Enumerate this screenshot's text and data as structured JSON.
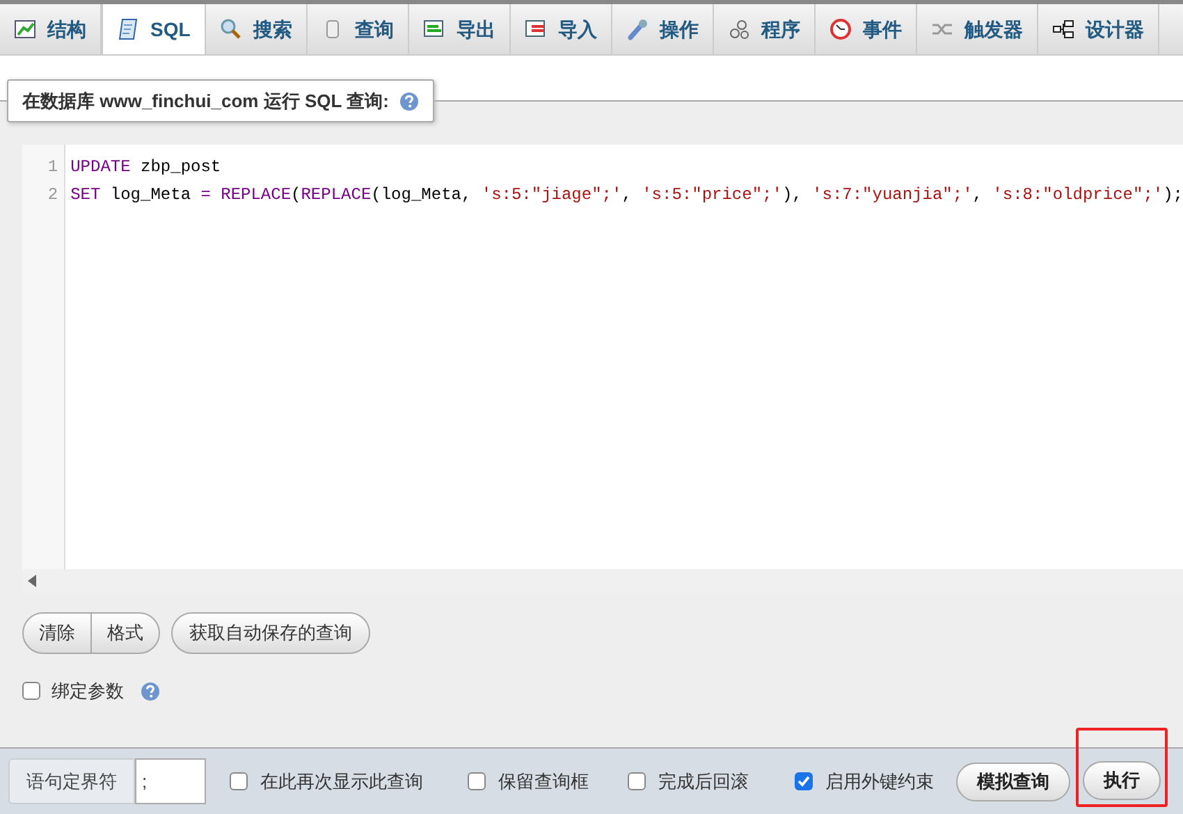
{
  "tabs": [
    {
      "label": "结构",
      "selected": false
    },
    {
      "label": "SQL",
      "selected": true
    },
    {
      "label": "搜索",
      "selected": false
    },
    {
      "label": "查询",
      "selected": false
    },
    {
      "label": "导出",
      "selected": false
    },
    {
      "label": "导入",
      "selected": false
    },
    {
      "label": "操作",
      "selected": false
    },
    {
      "label": "程序",
      "selected": false
    },
    {
      "label": "事件",
      "selected": false
    },
    {
      "label": "触发器",
      "selected": false
    },
    {
      "label": "设计器",
      "selected": false
    }
  ],
  "panel": {
    "title": "在数据库 www_finchui_com 运行 SQL 查询:"
  },
  "editor": {
    "lines": [
      {
        "number": "1",
        "tokens": [
          {
            "kind": "keyword",
            "text": "UPDATE"
          },
          {
            "kind": "plain",
            "text": " zbp_post"
          }
        ]
      },
      {
        "number": "2",
        "tokens": [
          {
            "kind": "keyword",
            "text": "SET"
          },
          {
            "kind": "plain",
            "text": " log_Meta "
          },
          {
            "kind": "keyword",
            "text": "= REPLACE"
          },
          {
            "kind": "plain",
            "text": "("
          },
          {
            "kind": "keyword",
            "text": "REPLACE"
          },
          {
            "kind": "plain",
            "text": "(log_Meta, "
          },
          {
            "kind": "string",
            "text": "'s:5:\"jiage\";'"
          },
          {
            "kind": "plain",
            "text": ", "
          },
          {
            "kind": "string",
            "text": "'s:5:\"price\";'"
          },
          {
            "kind": "plain",
            "text": "), "
          },
          {
            "kind": "string",
            "text": "'s:7:\"yuanjia\";'"
          },
          {
            "kind": "plain",
            "text": ", "
          },
          {
            "kind": "string",
            "text": "'s:8:\"oldprice\";'"
          },
          {
            "kind": "plain",
            "text": ");"
          }
        ]
      }
    ]
  },
  "editor_buttons": [
    {
      "label": "清除"
    },
    {
      "label": "格式"
    },
    {
      "label": "获取自动保存的查询"
    }
  ],
  "bind_parameters": {
    "label": "绑定参数",
    "checked": false
  },
  "footer": {
    "delimiter_label": "语句定界符",
    "delimiter_value": ";",
    "options": [
      {
        "label": "在此再次显示此查询",
        "checked": false
      },
      {
        "label": "保留查询框",
        "checked": false
      },
      {
        "label": "完成后回滚",
        "checked": false
      },
      {
        "label": "启用外键约束",
        "checked": true
      }
    ],
    "buttons": [
      {
        "label": "模拟查询",
        "highlighted": false
      },
      {
        "label": "执行",
        "highlighted": true
      }
    ]
  }
}
